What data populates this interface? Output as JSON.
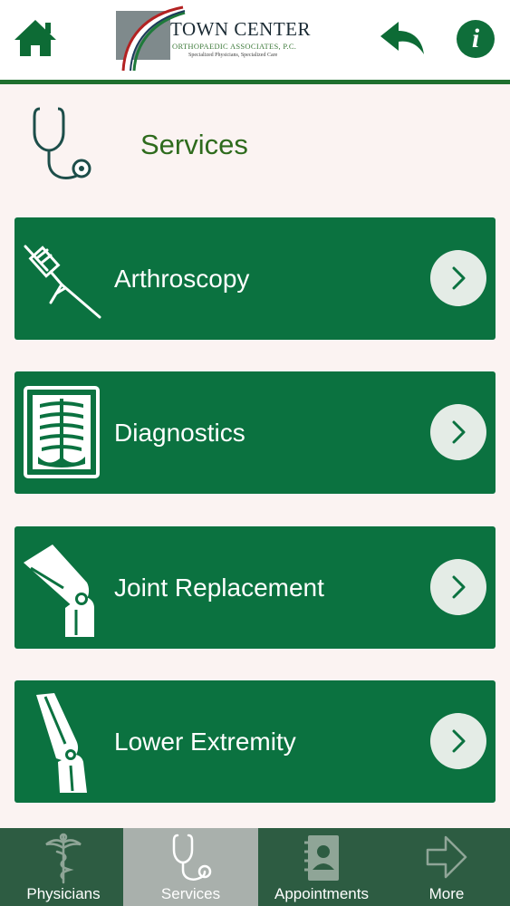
{
  "header": {
    "logo": {
      "title": "TOWN CENTER",
      "subtitle": "ORTHOPAEDIC ASSOCIATES, P.C.",
      "tagline": "Specialized Physicians, Specialized Care"
    },
    "home_icon": "home-icon",
    "back_icon": "back-arrow-icon",
    "info_icon": "info-icon",
    "info_glyph": "i"
  },
  "section": {
    "title": "Services",
    "icon": "stethoscope-icon"
  },
  "services": [
    {
      "label": "Arthroscopy",
      "icon": "arthroscope-icon"
    },
    {
      "label": "Diagnostics",
      "icon": "xray-icon"
    },
    {
      "label": "Joint Replacement",
      "icon": "knee-joint-icon"
    },
    {
      "label": "Lower Extremity",
      "icon": "leg-icon"
    }
  ],
  "tabs": [
    {
      "label": "Physicians",
      "icon": "caduceus-icon",
      "active": false
    },
    {
      "label": "Services",
      "icon": "stethoscope-icon",
      "active": true
    },
    {
      "label": "Appointments",
      "icon": "address-book-icon",
      "active": false
    },
    {
      "label": "More",
      "icon": "arrow-right-icon",
      "active": false
    }
  ],
  "colors": {
    "brand_green": "#0b7240",
    "title_green": "#2e6b1d",
    "header_line": "#1f6f2f",
    "tabbar": "#2d5c42",
    "active_tab": "#a9b0ac",
    "background": "#fbf3f2"
  }
}
